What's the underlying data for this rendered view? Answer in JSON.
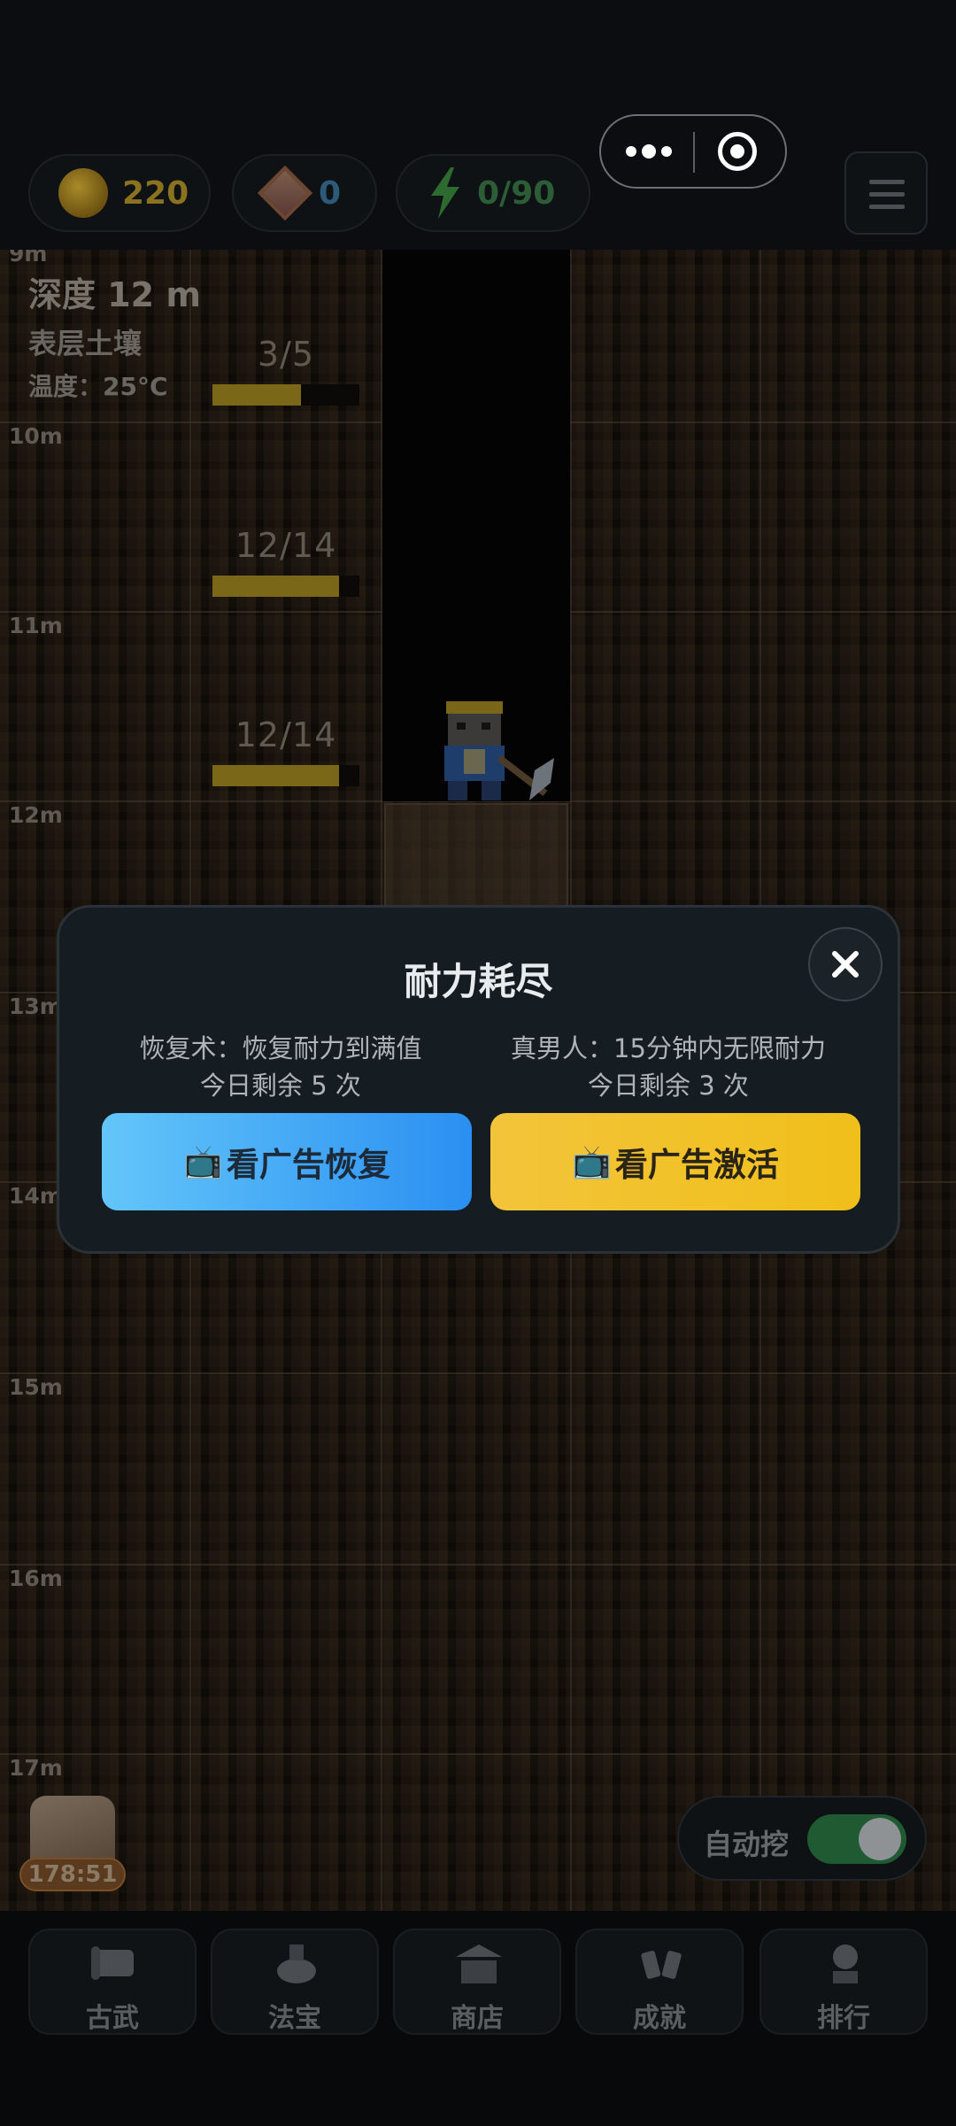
{
  "resources": {
    "coins": "220",
    "gems": "0",
    "energy": "0/90"
  },
  "mine": {
    "depth_title": "深度 12 m",
    "layer_name": "表层土壤",
    "temperature": "温度：25°C",
    "depth_marks": [
      "9m",
      "10m",
      "11m",
      "12m",
      "13m",
      "14m",
      "15m",
      "16m",
      "17m"
    ],
    "blocks": [
      {
        "label": "3/5",
        "hp": 0.6
      },
      {
        "label": "12/14",
        "hp": 0.86
      },
      {
        "label": "12/14",
        "hp": 0.86
      }
    ]
  },
  "boost": {
    "timer": "178:51"
  },
  "auto_dig": {
    "label": "自动挖",
    "on": true
  },
  "nav": {
    "items": [
      "古武",
      "法宝",
      "商店",
      "成就",
      "排行"
    ]
  },
  "modal": {
    "title": "耐力耗尽",
    "left": {
      "desc": "恢复术：恢复耐力到满值",
      "remaining": "今日剩余 5 次",
      "button": "看广告恢复"
    },
    "right": {
      "desc": "真男人：15分钟内无限耐力",
      "remaining": "今日剩余 3 次",
      "button": "看广告激活"
    },
    "tv_icon": "📺"
  },
  "colors": {
    "accent_blue": "#2b8ff2",
    "accent_yellow": "#f0bf1a",
    "modal_bg": "#151c22"
  }
}
